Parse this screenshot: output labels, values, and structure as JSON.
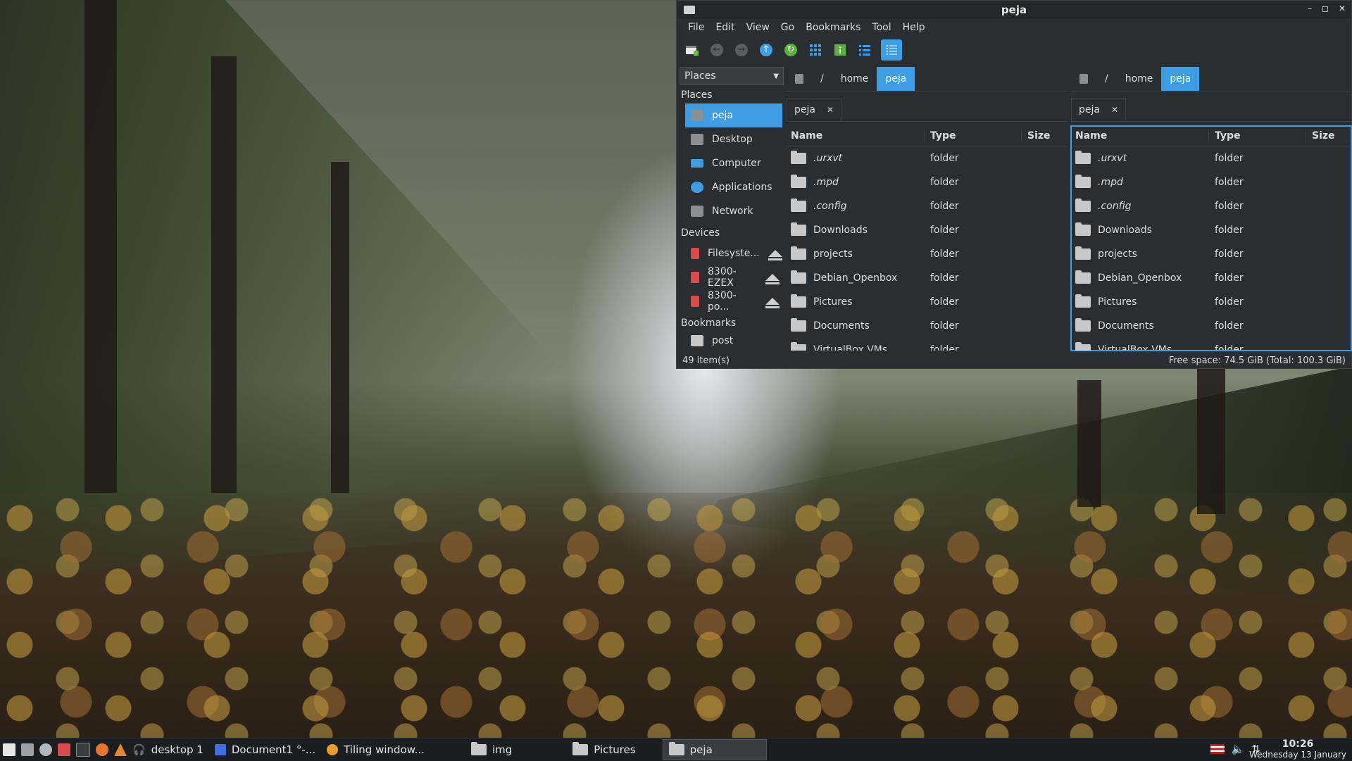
{
  "window": {
    "title": "peja",
    "controls": [
      "–",
      "◻",
      "✕"
    ]
  },
  "menu": [
    "File",
    "Edit",
    "View",
    "Go",
    "Bookmarks",
    "Tool",
    "Help"
  ],
  "sidebar": {
    "dropdown_label": "Places",
    "places_header": "Places",
    "places": [
      {
        "label": "peja",
        "icon": "home-folder-icon"
      },
      {
        "label": "Desktop",
        "icon": "desktop-icon"
      },
      {
        "label": "Computer",
        "icon": "computer-icon"
      },
      {
        "label": "Applications",
        "icon": "applications-icon"
      },
      {
        "label": "Network",
        "icon": "network-icon"
      }
    ],
    "devices_header": "Devices",
    "devices": [
      {
        "label": "Filesyste..."
      },
      {
        "label": "8300-EZEX"
      },
      {
        "label": "8300-po..."
      }
    ],
    "bookmarks_header": "Bookmarks",
    "bookmarks": [
      {
        "label": "post"
      }
    ]
  },
  "left_pane": {
    "breadcrumb": [
      "/",
      "home",
      "peja"
    ],
    "tab": "peja",
    "columns": [
      "Name",
      "Type",
      "Size"
    ],
    "rows": [
      {
        "name": ".urxvt",
        "type": "folder"
      },
      {
        "name": ".mpd",
        "type": "folder"
      },
      {
        "name": ".config",
        "type": "folder"
      },
      {
        "name": "Downloads",
        "type": "folder"
      },
      {
        "name": "projects",
        "type": "folder"
      },
      {
        "name": "Debian_Openbox",
        "type": "folder"
      },
      {
        "name": "Pictures",
        "type": "folder"
      },
      {
        "name": "Documents",
        "type": "folder"
      },
      {
        "name": "VirtualBox VMs",
        "type": "folder"
      }
    ]
  },
  "right_pane": {
    "breadcrumb": [
      "/",
      "home",
      "peja"
    ],
    "tab": "peja",
    "columns": [
      "Name",
      "Type",
      "Size"
    ],
    "rows": [
      {
        "name": ".urxvt",
        "type": "folder"
      },
      {
        "name": ".mpd",
        "type": "folder"
      },
      {
        "name": ".config",
        "type": "folder"
      },
      {
        "name": "Downloads",
        "type": "folder"
      },
      {
        "name": "projects",
        "type": "folder"
      },
      {
        "name": "Debian_Openbox",
        "type": "folder"
      },
      {
        "name": "Pictures",
        "type": "folder"
      },
      {
        "name": "Documents",
        "type": "folder"
      },
      {
        "name": "VirtualBox VMs",
        "type": "folder"
      }
    ]
  },
  "status": {
    "items": "49 item(s)",
    "free_space": "Free space: 74.5 GiB (Total: 100.3 GiB)"
  },
  "taskbar": {
    "tasks": [
      {
        "label": "desktop 1"
      },
      {
        "label": "Document1 °-..."
      },
      {
        "label": "Tiling window..."
      },
      {
        "label": "img"
      },
      {
        "label": "Pictures"
      },
      {
        "label": "peja"
      }
    ],
    "clock_time": "10:26",
    "clock_date": "Wednesday 13 January"
  },
  "colors": {
    "accent": "#3d9ee6",
    "window_bg": "#2b2e31",
    "taskbar_bg": "#1b1d1f"
  }
}
